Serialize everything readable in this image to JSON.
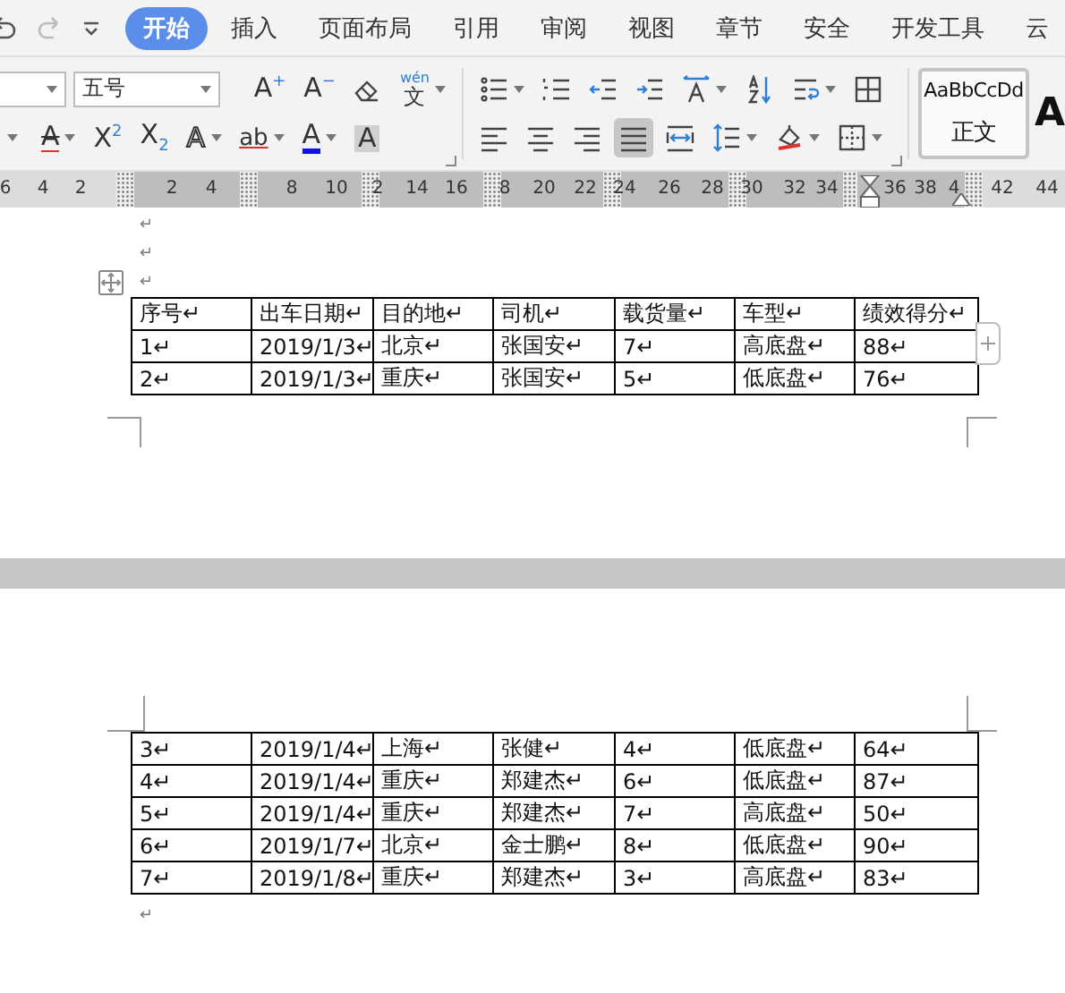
{
  "quick_access": [
    {
      "kind": "undo",
      "disabled": false
    },
    {
      "kind": "redo",
      "disabled": true
    },
    {
      "kind": "menu",
      "disabled": false
    }
  ],
  "tabs": [
    {
      "label": "开始",
      "selected": true
    },
    {
      "label": "插入",
      "selected": false
    },
    {
      "label": "页面布局",
      "selected": false
    },
    {
      "label": "引用",
      "selected": false
    },
    {
      "label": "审阅",
      "selected": false
    },
    {
      "label": "视图",
      "selected": false
    },
    {
      "label": "章节",
      "selected": false
    },
    {
      "label": "安全",
      "selected": false
    },
    {
      "label": "开发工具",
      "selected": false
    },
    {
      "label": "云",
      "selected": false
    }
  ],
  "font_group": {
    "row_1": [
      {
        "kind": "font-field"
      },
      {
        "kind": "size-field",
        "value": "五号"
      },
      {
        "kind": "glyph",
        "text": "A$^{+}$",
        "dropdown": false,
        "selected": false
      },
      {
        "kind": "glyph",
        "text": "A$^{−}$",
        "dropdown": false,
        "selected": false
      },
      {
        "kind": "icon",
        "dropdown": false,
        "selected": false
      },
      {
        "kind": "ruby",
        "top": "wén",
        "text": "文",
        "dropdown": true,
        "selected": false
      }
    ],
    "row_2": [
      {
        "kind": "caret"
      },
      {
        "kind": "glyph",
        "text": "A",
        "dropdown": true,
        "selected": false
      },
      {
        "kind": "glyph",
        "text": "X$^{2}$",
        "dropdown": false,
        "selected": false
      },
      {
        "kind": "glyph",
        "text": "X$_{2}$",
        "dropdown": false,
        "selected": false
      },
      {
        "kind": "glyph",
        "text": "A",
        "dropdown": true,
        "selected": false
      },
      {
        "kind": "glyph",
        "text": "ab",
        "dropdown": true,
        "selected": false
      },
      {
        "kind": "glyph",
        "text": "A",
        "dropdown": true,
        "selected": false
      },
      {
        "kind": "glyph",
        "text": "A",
        "dropdown": false,
        "selected": false
      }
    ]
  },
  "paragraph_group": {
    "row_1": [
      {
        "kind": "icon",
        "dropdown": true,
        "selected": false
      },
      {
        "kind": "icon",
        "dropdown": false,
        "selected": false
      },
      {
        "kind": "icon",
        "dropdown": false,
        "selected": false
      },
      {
        "kind": "icon",
        "dropdown": false,
        "selected": false
      },
      {
        "kind": "icon",
        "dropdown": true,
        "selected": false
      },
      {
        "kind": "icon",
        "dropdown": false,
        "selected": false
      },
      {
        "kind": "icon",
        "dropdown": true,
        "selected": false
      },
      {
        "kind": "icon",
        "dropdown": false,
        "selected": false
      }
    ],
    "row_2": [
      {
        "kind": "icon",
        "dropdown": false,
        "selected": false
      },
      {
        "kind": "icon",
        "dropdown": false,
        "selected": false
      },
      {
        "kind": "icon",
        "dropdown": false,
        "selected": false
      },
      {
        "kind": "icon",
        "dropdown": false,
        "selected": true
      },
      {
        "kind": "icon",
        "dropdown": false,
        "selected": false
      },
      {
        "kind": "icon",
        "dropdown": true,
        "selected": false
      },
      {
        "kind": "icon",
        "dropdown": true,
        "selected": false
      },
      {
        "kind": "icon",
        "dropdown": true,
        "selected": false
      }
    ]
  },
  "styles": [
    {
      "preview": "AaBbCcDd",
      "name": "正文",
      "selected": true
    },
    {
      "preview": "A",
      "selected": false
    }
  ],
  "ruler": {
    "labels": [
      "6",
      "4",
      "2",
      "2",
      "4",
      "8",
      "10",
      "2",
      "14",
      "16",
      "8",
      "20",
      "22",
      "24",
      "26",
      "28",
      "30",
      "32",
      "34",
      "36",
      "38",
      "4",
      "42",
      "44"
    ]
  },
  "page_1": {
    "paragraphs_before": [
      "↵",
      "↵",
      "↵"
    ],
    "table": {
      "columns": [
        "序号↵",
        "出车日期↵",
        "目的地↵",
        "司机↵",
        "载货量↵",
        "车型↵",
        "绩效得分↵"
      ],
      "rows": [
        [
          "1↵",
          "2019/1/3↵",
          "北京↵",
          "张国安↵",
          "7↵",
          "高底盘↵",
          "88↵"
        ],
        [
          "2↵",
          "2019/1/3↵",
          "重庆↵",
          "张国安↵",
          "5↵",
          "低底盘↵",
          "76↵"
        ]
      ]
    }
  },
  "page_2": {
    "table": {
      "rows": [
        [
          "3↵",
          "2019/1/4↵",
          "上海↵",
          "张健↵",
          "4↵",
          "低底盘↵",
          "64↵"
        ],
        [
          "4↵",
          "2019/1/4↵",
          "重庆↵",
          "郑建杰↵",
          "6↵",
          "低底盘↵",
          "87↵"
        ],
        [
          "5↵",
          "2019/1/4↵",
          "重庆↵",
          "郑建杰↵",
          "7↵",
          "高底盘↵",
          "50↵"
        ],
        [
          "6↵",
          "2019/1/7↵",
          "北京↵",
          "金士鹏↵",
          "8↵",
          "低底盘↵",
          "90↵"
        ],
        [
          "7↵",
          "2019/1/8↵",
          "重庆↵",
          "郑建杰↵",
          "3↵",
          "高底盘↵",
          "83↵"
        ]
      ]
    },
    "paragraphs_after": [
      "↵"
    ]
  }
}
